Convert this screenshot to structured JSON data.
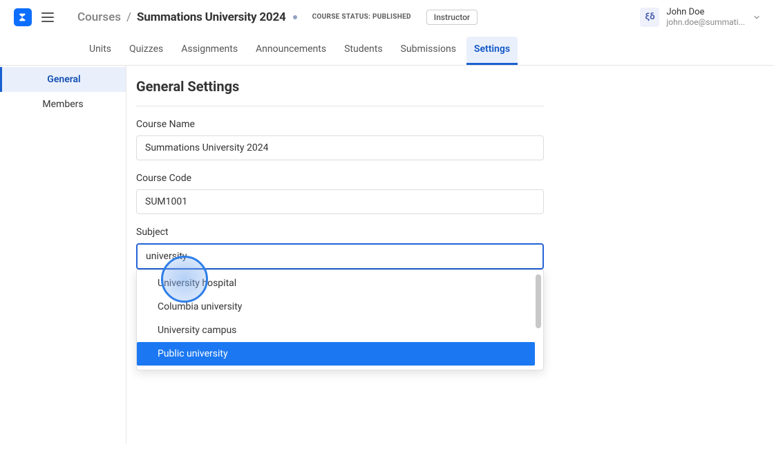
{
  "breadcrumb": {
    "root": "Courses",
    "sep": "/",
    "current": "Summations University 2024"
  },
  "course_status": "COURSE STATUS: PUBLISHED",
  "role": "Instructor",
  "user": {
    "avatar_text": "ξδ",
    "name": "John Doe",
    "email": "john.doe@summati..."
  },
  "tabs": [
    {
      "label": "Units"
    },
    {
      "label": "Quizzes"
    },
    {
      "label": "Assignments"
    },
    {
      "label": "Announcements"
    },
    {
      "label": "Students"
    },
    {
      "label": "Submissions"
    },
    {
      "label": "Settings"
    }
  ],
  "sidebar": {
    "items": [
      {
        "label": "General"
      },
      {
        "label": "Members"
      }
    ]
  },
  "page_title": "General Settings",
  "form": {
    "course_name": {
      "label": "Course Name",
      "value": "Summations University 2024"
    },
    "course_code": {
      "label": "Course Code",
      "value": "SUM1001"
    },
    "subject": {
      "label": "Subject",
      "value": "university"
    }
  },
  "dropdown": {
    "options": [
      {
        "label": "University hospital"
      },
      {
        "label": "Columbia university"
      },
      {
        "label": "University campus"
      },
      {
        "label": "Public university"
      }
    ]
  }
}
